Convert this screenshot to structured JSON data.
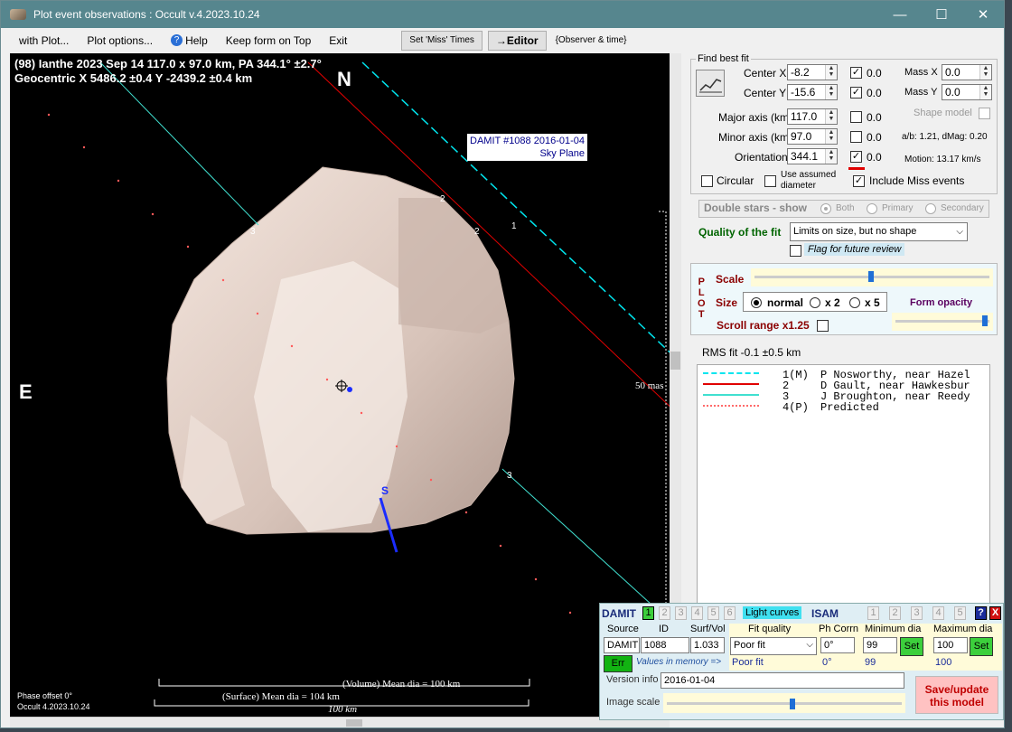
{
  "window": {
    "title": "Plot event observations : Occult v.4.2023.10.24",
    "min": "—",
    "max": "☐",
    "close": "✕"
  },
  "menu": {
    "with_plot": "with Plot...",
    "plot_options": "Plot options...",
    "help": "Help",
    "keep_on_top": "Keep form on Top",
    "exit": "Exit",
    "set_miss": "Set 'Miss' Times",
    "editor": "→Editor",
    "observer_time": "{Observer & time}"
  },
  "plot": {
    "header1": "(98) Ianthe  2023 Sep 14   117.0 x 97.0 km, PA 344.1° ±2.7°",
    "header2": "Geocentric  X  5486.2 ±0.4  Y -2439.2 ±0.4 km",
    "north": "N",
    "east": "E",
    "south_marker": "S",
    "model_label1": "DAMIT #1088 2016-01-04",
    "model_label2": "Sky Plane",
    "scale_mas": "50 mas",
    "vol_dia": "(Volume) Mean dia = 100 km",
    "surf_dia": "(Surface) Mean dia = 104 km",
    "scale_km": "100 km",
    "phase_offset": "Phase offset 0°",
    "occult_version": "Occult 4.2023.10.24",
    "chord_labels": [
      "2",
      "1",
      "3",
      "3",
      "2"
    ]
  },
  "fit": {
    "group_title": "Find best fit",
    "center_x_label": "Center X",
    "center_x": "-8.2",
    "center_y_label": "Center Y",
    "center_y": "-15.6",
    "major_label": "Major axis (km)",
    "major": "117.0",
    "minor_label": "Minor axis (km)",
    "minor": "97.0",
    "orient_label": "Orientation",
    "orient": "344.1",
    "val_cx": "0.0",
    "val_cy": "0.0",
    "val_major": "0.0",
    "val_minor": "0.0",
    "val_orient": "0.0",
    "mass_x_label": "Mass X",
    "mass_x": "0.0",
    "mass_y_label": "Mass Y",
    "mass_y": "0.0",
    "shape_model_label": "Shape model",
    "ab": "a/b: 1.21, dMag: 0.20",
    "motion": "Motion: 13.17 km/s",
    "circular": "Circular",
    "use_assumed1": "Use assumed",
    "use_assumed2": "diameter",
    "include_miss": "Include Miss events",
    "double_stars": "Double stars - show",
    "both": "Both",
    "primary": "Primary",
    "secondary": "Secondary",
    "quality_label": "Quality of the fit",
    "quality_value": "Limits on size, but no shape",
    "flag_review": "Flag for future review"
  },
  "plotbox": {
    "side": [
      "P",
      "L",
      "O",
      "T"
    ],
    "scale": "Scale",
    "size": "Size",
    "normal": "normal",
    "x2": "x 2",
    "x5": "x 5",
    "form_opacity": "Form opacity",
    "scroll_range": "Scroll range x1.25"
  },
  "rms": "RMS fit -0.1 ±0.5 km",
  "legend": [
    {
      "num": "1(M)",
      "text": "P Nosworthy, near Hazel",
      "color": "#00e5ee",
      "style": "dash"
    },
    {
      "num": "2",
      "text": "D Gault, near Hawkesbur",
      "color": "#e00000",
      "style": "solid"
    },
    {
      "num": "3",
      "text": "J Broughton, near Reedy",
      "color": "#40e0d0",
      "style": "solid"
    },
    {
      "num": "4(P)",
      "text": "Predicted",
      "color": "#ff6a6a",
      "style": "dots"
    }
  ],
  "damit": {
    "damit": "DAMIT",
    "isam": "ISAM",
    "light_curves": "Light curves",
    "nums": [
      "1",
      "2",
      "3",
      "4",
      "5",
      "6"
    ],
    "source_h": "Source",
    "id_h": "ID",
    "surf_h": "Surf/Vol",
    "fitq_h": "Fit quality",
    "phcorr_h": "Ph Corrn",
    "mindia_h": "Minimum dia",
    "maxdia_h": "Maximum dia",
    "source": "DAMIT",
    "id": "1088",
    "surf": "1.033",
    "fitq": "Poor fit",
    "phcorr": "0°",
    "mindia": "99",
    "maxdia": "100",
    "set": "Set",
    "err": "Err",
    "values_mem": "Values in memory =>",
    "mem_fit": "Poor fit",
    "mem_ph": "0°",
    "mem_min": "99",
    "mem_max": "100",
    "version_label": "Version info",
    "version": "2016-01-04",
    "image_scale": "Image scale",
    "save1": "Save/update",
    "save2": "this model",
    "help": "?",
    "close": "X"
  }
}
